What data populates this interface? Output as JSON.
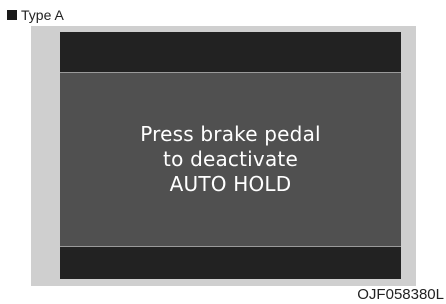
{
  "caption": {
    "type_label": "Type A",
    "bullet_icon": "square-bullet-icon"
  },
  "display": {
    "message_lines": [
      "Press brake pedal",
      "to deactivate",
      "AUTO HOLD"
    ]
  },
  "footer": {
    "image_code": "OJF058380L"
  },
  "colors": {
    "panel_background": "#cfcfcf",
    "frame_dark": "#222222",
    "screen": "#505050",
    "message_text": "#ffffff"
  }
}
